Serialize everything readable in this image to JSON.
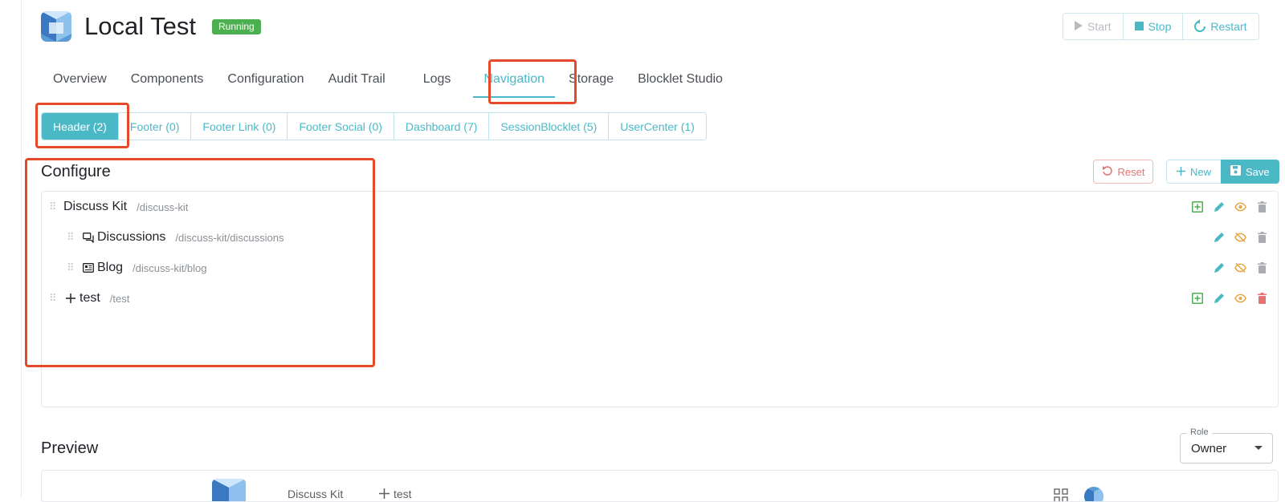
{
  "app": {
    "title": "Local Test",
    "status": "Running",
    "actions": {
      "start": "Start",
      "stop": "Stop",
      "restart": "Restart"
    }
  },
  "tabs": [
    {
      "label": "Overview"
    },
    {
      "label": "Components"
    },
    {
      "label": "Configuration"
    },
    {
      "label": "Audit Trail"
    },
    {
      "label": "Logs"
    },
    {
      "label": "Navigation",
      "active": true
    },
    {
      "label": "Storage"
    },
    {
      "label": "Blocklet Studio"
    }
  ],
  "subtabs": [
    {
      "label": "Header (2)",
      "active": true
    },
    {
      "label": "Footer (0)"
    },
    {
      "label": "Footer Link (0)"
    },
    {
      "label": "Footer Social (0)"
    },
    {
      "label": "Dashboard (7)"
    },
    {
      "label": "SessionBlocklet (5)"
    },
    {
      "label": "UserCenter (1)"
    }
  ],
  "configure": {
    "title": "Configure",
    "reset_label": "Reset",
    "new_label": "New",
    "save_label": "Save",
    "items": [
      {
        "title": "Discuss Kit",
        "path": "/discuss-kit",
        "icon": "none",
        "level": 0,
        "visible": true
      },
      {
        "title": "Discussions",
        "path": "/discuss-kit/discussions",
        "icon": "forum-icon",
        "level": 1,
        "visible": false
      },
      {
        "title": "Blog",
        "path": "/discuss-kit/blog",
        "icon": "article-icon",
        "level": 1,
        "visible": false
      },
      {
        "title": "test",
        "path": "/test",
        "icon": "plus-icon",
        "level": 0,
        "visible": true
      }
    ]
  },
  "preview": {
    "title": "Preview",
    "role_label": "Role",
    "role_value": "Owner",
    "nav_items": [
      "Discuss Kit",
      "test"
    ]
  },
  "colors": {
    "accent": "#4bb8c6",
    "running": "#4caf50",
    "highlight": "#e4492a",
    "danger": "#e57373",
    "add": "#4caf50",
    "eye": "#e6a23c"
  }
}
